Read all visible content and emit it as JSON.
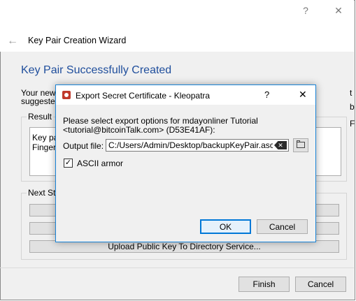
{
  "wizard": {
    "window_help": "?",
    "window_close": "✕",
    "back_arrow": "←",
    "title": "Key Pair Creation Wizard",
    "heading": "Key Pair Successfully Created",
    "intro_line1": "Your new",
    "intro_line2": "suggested",
    "result_legend": "Result",
    "result_line1": "Key pa",
    "result_line2": "Fingerp",
    "next_steps_legend": "Next Ste",
    "next_buttons": [
      "",
      "",
      "Upload Public Key To Directory Service..."
    ],
    "finish_label": "Finish",
    "cancel_label": "Cancel"
  },
  "dialog": {
    "title": "Export Secret Certificate - Kleopatra",
    "help": "?",
    "close": "✕",
    "message_line1": "Please select export options for mdayonliner Tutorial",
    "message_line2": "<tutorial@bitcoinTalk.com> (D53E41AF):",
    "output_label": "Output file:",
    "output_value": "C:/Users/Admin/Desktop/backupKeyPair.asc",
    "ascii_label": "ASCII armor",
    "ascii_checked": true,
    "check_mark": "✓",
    "clear_glyph": "✕",
    "ok_label": "OK",
    "cancel_label": "Cancel"
  },
  "accent_color": "#1f4e9c",
  "focus_color": "#0078d7"
}
